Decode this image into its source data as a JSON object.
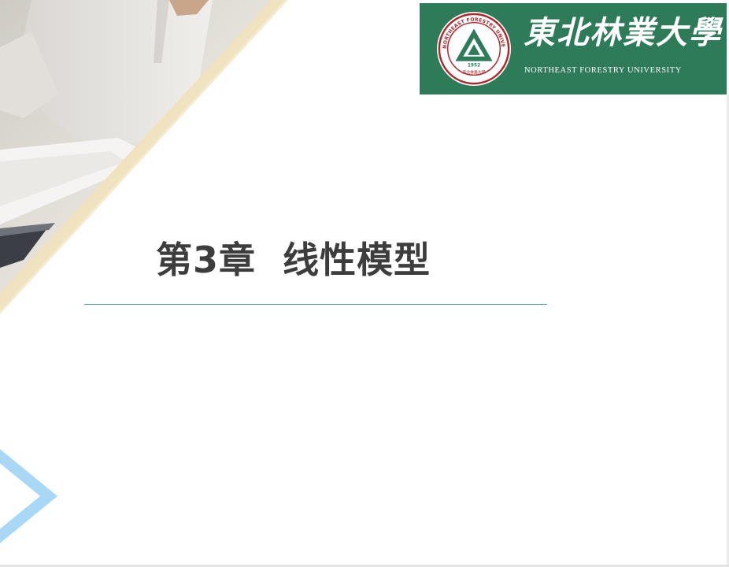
{
  "slide": {
    "title": "第3章  线性模型"
  },
  "logo": {
    "name_cn": "東北林業大學",
    "name_en": "NORTHEAST FORESTRY UNIVERSITY",
    "emblem_ring_text": "NORTHEAST FORESTRY UNIVERSITY",
    "emblem_year": "1952",
    "emblem_motto": "東北林業大學"
  },
  "colors": {
    "banner_green": "#2e7b5a",
    "title_text": "#3d3d3d",
    "rule_teal": "#4aa596",
    "chevron_blue": "#a9d8f7"
  },
  "icons": {
    "emblem": "university-emblem-icon",
    "chevron": "chevron-right-icon"
  }
}
